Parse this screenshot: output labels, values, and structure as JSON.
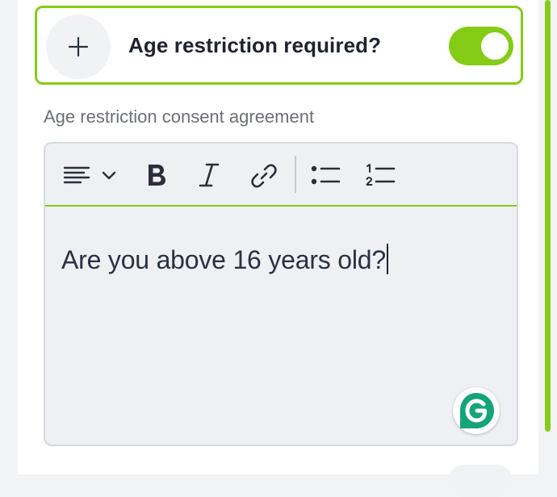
{
  "age_restriction": {
    "title": "Age restriction required?",
    "toggle_on": true,
    "add_icon": "plus-icon"
  },
  "consent": {
    "label": "Age restriction consent agreement",
    "content": "Are you above 16 years old?"
  },
  "toolbar": {
    "icons": [
      "align-left-icon",
      "chevron-down-icon",
      "bold-icon",
      "italic-icon",
      "link-icon",
      "bullet-list-icon",
      "numbered-list-icon"
    ]
  },
  "colors": {
    "accent": "#84cc16",
    "text": "#1f2330",
    "muted": "#6b6f79",
    "editor_bg": "#eef0f3"
  },
  "assistant": {
    "icon": "grammarly-icon"
  }
}
